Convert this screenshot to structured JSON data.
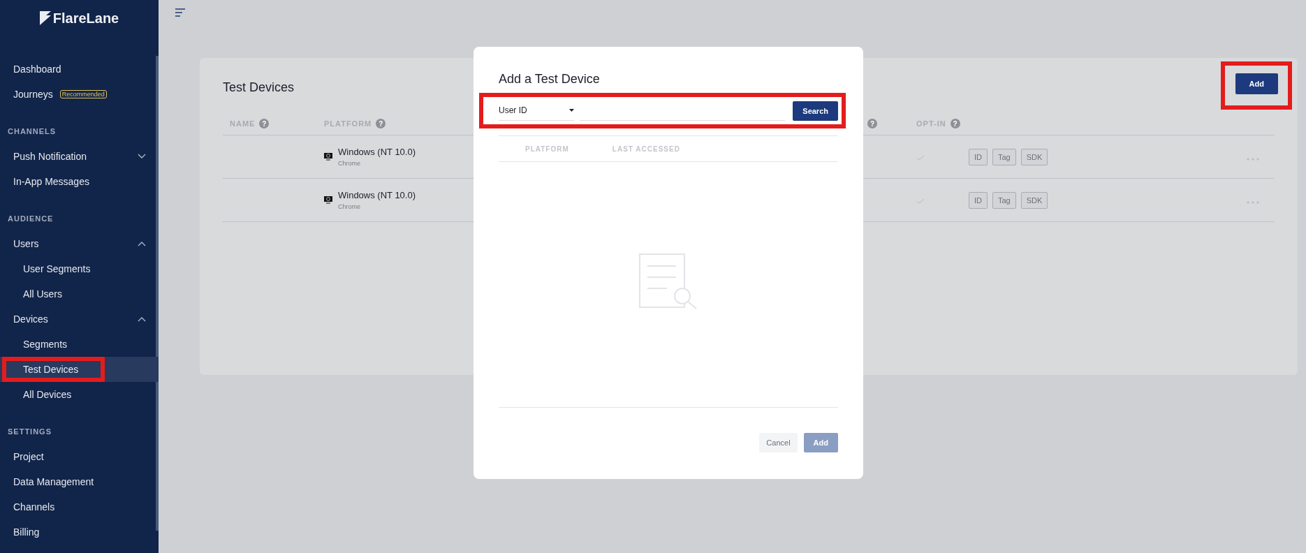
{
  "sidebar": {
    "logo": "FlareLane",
    "sections": [
      {
        "items": [
          {
            "label": "Dashboard",
            "selected": false
          },
          {
            "label": "Journeys",
            "badge": "Recommended",
            "selected": false
          }
        ]
      },
      {
        "heading": "CHANNELS",
        "items": [
          {
            "label": "Push Notification",
            "expanded": false,
            "selected": false
          },
          {
            "label": "In-App Messages",
            "selected": false
          }
        ]
      },
      {
        "heading": "AUDIENCE",
        "items": [
          {
            "label": "Users",
            "expanded": true,
            "selected": false,
            "children": [
              {
                "label": "User Segments",
                "selected": false,
                "highlighted": false
              },
              {
                "label": "All Users",
                "selected": false,
                "highlighted": false
              }
            ]
          },
          {
            "label": "Devices",
            "expanded": true,
            "selected": false,
            "children": [
              {
                "label": "Segments",
                "selected": false,
                "highlighted": false
              },
              {
                "label": "Test Devices",
                "selected": true,
                "highlighted": true
              },
              {
                "label": "All Devices",
                "selected": false,
                "highlighted": false
              }
            ]
          }
        ]
      },
      {
        "heading": "SETTINGS",
        "items": [
          {
            "label": "Project",
            "selected": false
          },
          {
            "label": "Data Management",
            "selected": false
          },
          {
            "label": "Channels",
            "selected": false
          },
          {
            "label": "Billing",
            "selected": false
          }
        ]
      }
    ]
  },
  "card": {
    "title": "Test Devices",
    "add_button": {
      "label": "Add",
      "highlighted": true
    },
    "columns": [
      {
        "label": "NAME",
        "help": "?"
      },
      {
        "label": "PLATFORM",
        "help": "?"
      },
      {
        "help": "?"
      },
      {
        "label": "OPT-IN",
        "help": "?"
      }
    ],
    "rows": [
      {
        "platform": "Windows (NT 10.0)",
        "browser": "Chrome",
        "opted_in": true,
        "actions": [
          "ID",
          "Tag",
          "SDK"
        ]
      },
      {
        "platform": "Windows (NT 10.0)",
        "browser": "Chrome",
        "opted_in": true,
        "actions": [
          "ID",
          "Tag",
          "SDK"
        ]
      }
    ]
  },
  "modal": {
    "title": "Add a Test Device",
    "search_type": "User ID",
    "search_button": "Search",
    "highlighted": true,
    "columns": [
      "PLATFORM",
      "LAST ACCESSED"
    ],
    "cancel": "Cancel",
    "add": {
      "label": "Add",
      "disabled": true
    }
  }
}
